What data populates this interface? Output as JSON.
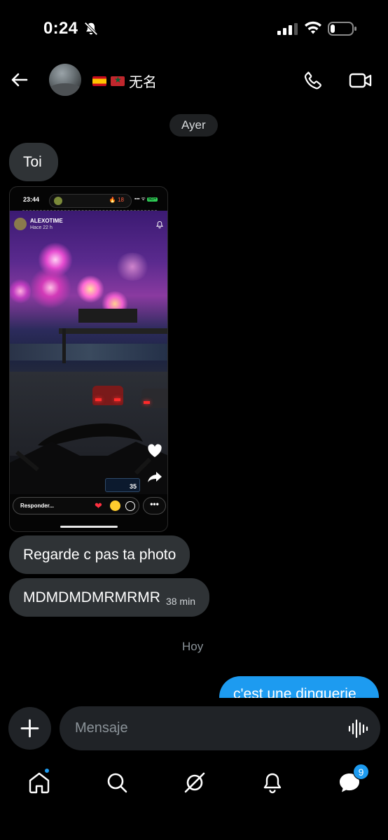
{
  "status_bar": {
    "time": "0:24",
    "icons": [
      "bell-slash-icon",
      "signal-icon",
      "wifi-icon",
      "battery-icon"
    ]
  },
  "header": {
    "contact_name": "无名",
    "flags": [
      "spain-flag",
      "morocco-flag"
    ],
    "icons": [
      "back-arrow-icon",
      "phone-icon",
      "video-camera-icon"
    ]
  },
  "conversation": {
    "day_separator_1": "Ayer",
    "message_1": "Toi",
    "shared_screenshot": {
      "status_time": "23:44",
      "streak_count": "🔥 18",
      "network_label": "5G+",
      "story_username": "ALEXOTIME",
      "story_time_ago": "Hace 22 h",
      "reply_placeholder": "Responder...",
      "more_label": "•••",
      "speedometer_value": "35"
    },
    "message_2": "Regarde c pas ta photo",
    "message_3": "MDMDMDMRMRMR",
    "message_3_time": "38 min",
    "day_separator_2": "Hoy",
    "message_outgoing": "c'est une dinguerie"
  },
  "composer": {
    "placeholder": "Mensaje",
    "icons": [
      "plus-icon",
      "voice-waveform-icon"
    ]
  },
  "bottom_nav": {
    "items": [
      "home",
      "search",
      "grok",
      "notifications",
      "messages"
    ],
    "messages_badge": "9"
  },
  "colors": {
    "accent": "#1d9bf0",
    "incoming_bubble": "#2f3336",
    "input_bg": "#202327",
    "background": "#000000"
  }
}
